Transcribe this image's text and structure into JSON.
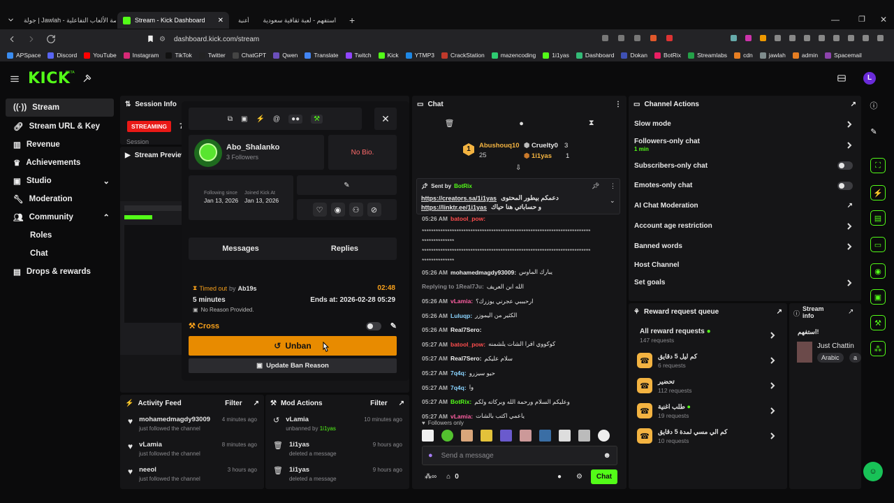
{
  "browser": {
    "tabs": [
      {
        "title": "جولة | Jawlah - منصة الألعاب التفاعلية"
      },
      {
        "title": "Stream - Kick Dashboard"
      },
      {
        "title": "استفهم - لعبة ثقافية سعودية"
      }
    ],
    "tab_extra": "أغنية",
    "address": "dashboard.kick.com/stream",
    "bookmarks": [
      "APSpace",
      "Discord",
      "YouTube",
      "Instagram",
      "TikTok",
      "Twitter",
      "ChatGPT",
      "Qwen",
      "Translate",
      "Twitch",
      "Kick",
      "YTMP3",
      "CrackStation",
      "mazencoding",
      "1i1yas",
      "Dashboard",
      "Dokan",
      "BotRix",
      "Streamlabs",
      "cdn",
      "jawlah",
      "admin",
      "Spacemail"
    ]
  },
  "kick": {
    "logo": "KICK",
    "beta": "BETA"
  },
  "sidebar": {
    "items": [
      {
        "label": "Stream"
      },
      {
        "label": "Stream URL & Key"
      },
      {
        "label": "Revenue"
      },
      {
        "label": "Achievements"
      },
      {
        "label": "Studio"
      },
      {
        "label": "Moderation"
      },
      {
        "label": "Community"
      },
      {
        "label": "Roles"
      },
      {
        "label": "Chat"
      },
      {
        "label": "Drops & rewards"
      }
    ]
  },
  "session": {
    "title": "Session Info",
    "status": "STREAMING",
    "session_label": "Session",
    "digit": "7"
  },
  "preview": {
    "title": "Stream Preview"
  },
  "user_card": {
    "username": "Abo_Shalanko",
    "followers": "3 Followers",
    "bio": "No Bio.",
    "following_label": "Following since",
    "following_date": "Jan 13, 2026",
    "joined_label": "Joined Kick At",
    "joined_date": "Jan 13, 2026",
    "tab_messages": "Messages",
    "tab_replies": "Replies",
    "timeout_label": "Timed out",
    "timeout_by": "by",
    "timeout_mod": "Ab19s",
    "timeout_timer": "02:48",
    "duration": "5 minutes",
    "ends": "Ends at: 2026-02-28 05:29",
    "reason": "No Reason Provided.",
    "cross_label": "Cross",
    "unban_label": "Unban",
    "update_label": "Update Ban Reason"
  },
  "activity": {
    "title": "Activity Feed",
    "filter": "Filter",
    "items": [
      {
        "user": "mohamedmagdy93009",
        "time": "4 minutes ago",
        "desc": "just followed the channel"
      },
      {
        "user": "vLamia",
        "time": "8 minutes ago",
        "desc": "just followed the channel"
      },
      {
        "user": "neeol",
        "time": "3 hours ago",
        "desc": "just followed the channel"
      }
    ]
  },
  "mod_actions": {
    "title": "Mod Actions",
    "filter": "Filter",
    "items": [
      {
        "user": "vLamia",
        "time": "10 minutes ago",
        "desc": "unbanned by",
        "by": "1i1yas"
      },
      {
        "user": "1i1yas",
        "time": "9 hours ago",
        "desc": "deleted a message",
        "by": ""
      },
      {
        "user": "1i1yas",
        "time": "9 hours ago",
        "desc": "deleted a message",
        "by": ""
      }
    ]
  },
  "chat": {
    "title": "Chat",
    "leaders": [
      {
        "name": "Abushouq10",
        "count": "25",
        "rank": "1"
      },
      {
        "name": "Cruelty0",
        "count": "3"
      },
      {
        "name": "1i1yas",
        "count": "1"
      }
    ],
    "pinned": {
      "sent_by": "Sent by",
      "bot": "BotRix",
      "text": "دعمكم بيطور المحتوى",
      "link1": "https://creators.sa/1i1yas",
      "link2": "https://linktr.ee/1i1yas",
      "text2": "و حساباتي هنا حياك"
    },
    "messages": [
      {
        "time": "05:26 AM",
        "user": "batool_pow:",
        "text": "",
        "color": "#ff4d4d"
      },
      {
        "time": "",
        "user": "",
        "text": "*************************************************************************",
        "color": "#ccc"
      },
      {
        "time": "",
        "user": "",
        "text": "**************",
        "color": "#ccc"
      },
      {
        "time": "",
        "user": "",
        "text": "*************************************************************************",
        "color": "#ccc"
      },
      {
        "time": "",
        "user": "",
        "text": "**************",
        "color": "#ccc"
      },
      {
        "time": "05:26 AM",
        "user": "mohamedmagdy93009:",
        "text": "يبارك الماوس",
        "color": "#f0f0f0"
      },
      {
        "time": "",
        "user": "Replying to 1Real7Ju:",
        "text": "الله ابن العريف",
        "color": "#8a8a8e"
      },
      {
        "time": "05:26 AM",
        "user": "vLamia:",
        "text": "ارحبببي عجرني يوزرك؟",
        "color": "#ff5fa2"
      },
      {
        "time": "05:26 AM",
        "user": "Luluqp:",
        "text": "الكثير من اليموزر",
        "color": "#8ad4ff"
      },
      {
        "time": "05:26 AM",
        "user": "Real7Sero:",
        "text": "",
        "color": "#f0f0f0"
      },
      {
        "time": "05:27 AM",
        "user": "batool_pow:",
        "text": "كوكووي افرا الشات يلشمنه",
        "color": "#ff4d4d"
      },
      {
        "time": "05:27 AM",
        "user": "Real7Sero:",
        "text": "سلام عليكم",
        "color": "#f0f0f0"
      },
      {
        "time": "05:27 AM",
        "user": "7q4q:",
        "text": "حيو سيزرو",
        "color": "#8ad4ff"
      },
      {
        "time": "05:27 AM",
        "user": "7q4q:",
        "text": "وا",
        "color": "#8ad4ff"
      },
      {
        "time": "05:27 AM",
        "user": "BotRix:",
        "text": "وعليكم السلام ورحمة الله وبركاته ولكم",
        "color": "#53fc18"
      },
      {
        "time": "05:27 AM",
        "user": "vLamia:",
        "text": "ياعمي اكتب بالشات",
        "color": "#ff5fa2"
      }
    ],
    "followers_only": "Followers only",
    "placeholder": "Send a message",
    "viewers": "0",
    "send": "Chat"
  },
  "channel_actions": {
    "title": "Channel Actions",
    "items": [
      {
        "label": "Slow mode",
        "sub": "",
        "kind": "chevron"
      },
      {
        "label": "Followers-only chat",
        "sub": "1 min",
        "kind": "chevron"
      },
      {
        "label": "Subscribers-only chat",
        "sub": "",
        "kind": "toggle"
      },
      {
        "label": "Emotes-only chat",
        "sub": "",
        "kind": "toggle"
      },
      {
        "label": "AI Chat Moderation",
        "sub": "",
        "kind": "external"
      },
      {
        "label": "Account age restriction",
        "sub": "",
        "kind": "chevron"
      },
      {
        "label": "Banned words",
        "sub": "",
        "kind": "chevron"
      },
      {
        "label": "Host Channel",
        "sub": "",
        "kind": "none"
      },
      {
        "label": "Set goals",
        "sub": "",
        "kind": "chevron"
      }
    ]
  },
  "rewards": {
    "title": "Reward request queue",
    "all": {
      "label": "All reward requests",
      "count": "147 requests"
    },
    "items": [
      {
        "label": "كم ليل 5 دقايق",
        "count": "6 requests"
      },
      {
        "label": "تحضير",
        "count": "112 requests"
      },
      {
        "label": "طلب اغنية",
        "count": "19 requests"
      },
      {
        "label": "كم الي مسي لمدة 5 دقايق",
        "count": "10 requests"
      }
    ]
  },
  "stream_info": {
    "title": "Stream",
    "title2": "info",
    "name": "استفهم!",
    "status": "Just Chattin",
    "tag1": "Arabic",
    "tag2": "a"
  }
}
